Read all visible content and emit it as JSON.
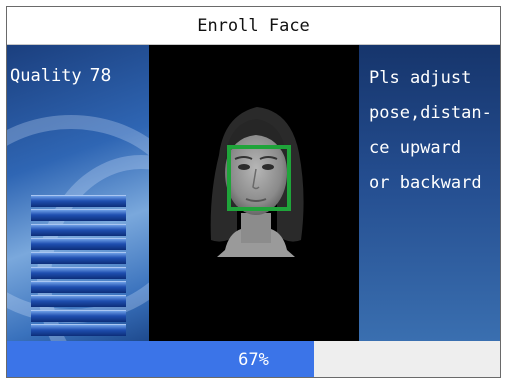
{
  "window": {
    "title": "Enroll Face"
  },
  "quality": {
    "label": "Quality",
    "value": "78"
  },
  "quality_meter": {
    "segments": 10
  },
  "instructions": {
    "text": "Pls adjust\npose,distan-\nce upward\nor backward"
  },
  "progress": {
    "label": "67%",
    "fraction": 0.67
  },
  "colors": {
    "face_box": "#1fa43a",
    "progress_fill": "#3b74e8",
    "panel_blue": "#244d8f"
  },
  "icons": {
    "face": "face-preview"
  }
}
